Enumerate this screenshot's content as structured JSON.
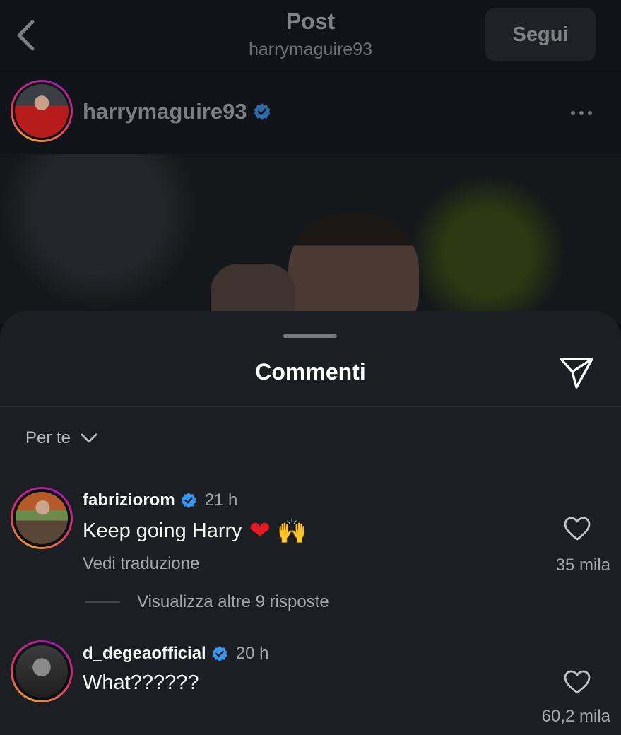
{
  "header": {
    "title": "Post",
    "subtitle": "harrymaguire93",
    "follow_label": "Segui"
  },
  "author": {
    "username": "harrymaguire93",
    "verified": true
  },
  "comments_sheet": {
    "title": "Commenti",
    "sort_label": "Per te",
    "comments": [
      {
        "username": "fabriziorom",
        "verified": true,
        "time": "21 h",
        "text": "Keep going Harry",
        "emojis": "❤️ 🙌",
        "translate_label": "Vedi traduzione",
        "likes": "35 mila",
        "replies_label": "Visualizza altre 9 risposte"
      },
      {
        "username": "d_degeaofficial",
        "verified": true,
        "time": "20 h",
        "text": "What??????",
        "likes": "60,2 mila"
      }
    ]
  },
  "colors": {
    "background": "#0c0f13",
    "sheet": "#1b1e22",
    "verified": "#3897f0",
    "story_ring": "#d72d6a"
  },
  "icons": [
    "back-chevron-icon",
    "verified-badge-icon",
    "more-options-icon",
    "send-icon",
    "chevron-down-icon",
    "heart-outline-icon"
  ]
}
